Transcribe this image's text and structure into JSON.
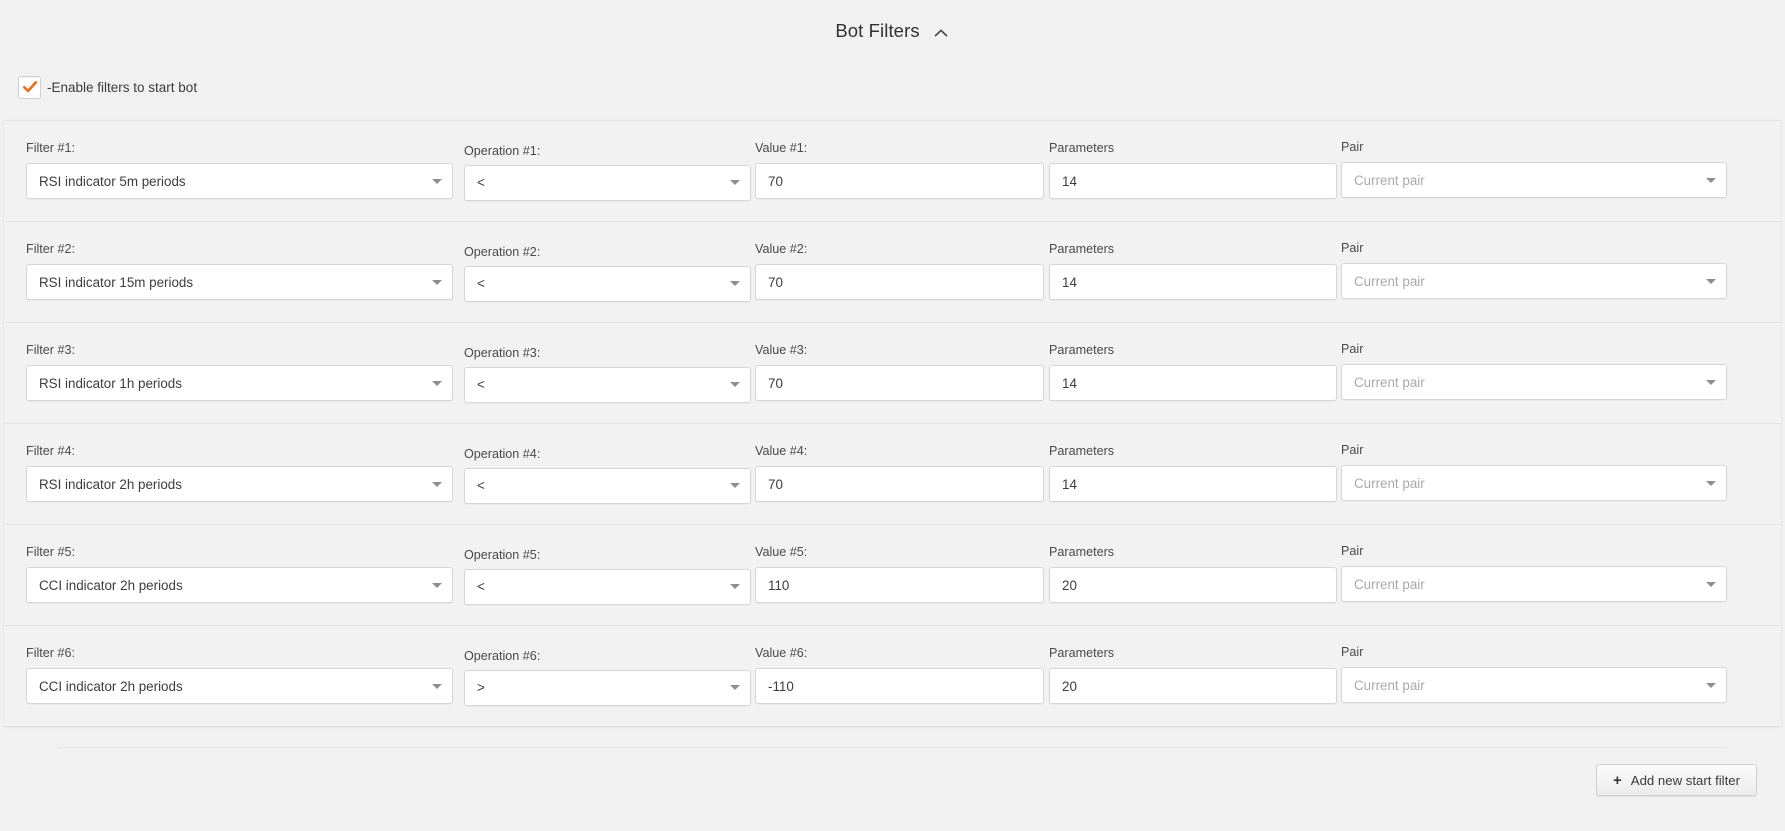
{
  "header": {
    "title": "Bot Filters",
    "collapse_icon": "chevron-up-icon"
  },
  "enable": {
    "label": "-Enable filters to start bot",
    "checked": true,
    "check_color": "#ef6c1a"
  },
  "labels": {
    "filter_prefix": "Filter #",
    "operation_prefix": "Operation #",
    "value_prefix": "Value #",
    "parameters": "Parameters",
    "pair": "Pair"
  },
  "rows": [
    {
      "index": "1",
      "filter_label": "Filter #1:",
      "filter_value": "RSI indicator 5m periods",
      "operation_label": "Operation #1:",
      "operation_value": "<",
      "value_label": "Value #1:",
      "value_value": "70",
      "parameters_label": "Parameters",
      "parameters_value": "14",
      "pair_label": "Pair",
      "pair_placeholder": "Current pair"
    },
    {
      "index": "2",
      "filter_label": "Filter #2:",
      "filter_value": "RSI indicator 15m periods",
      "operation_label": "Operation #2:",
      "operation_value": "<",
      "value_label": "Value #2:",
      "value_value": "70",
      "parameters_label": "Parameters",
      "parameters_value": "14",
      "pair_label": "Pair",
      "pair_placeholder": "Current pair"
    },
    {
      "index": "3",
      "filter_label": "Filter #3:",
      "filter_value": "RSI indicator 1h periods",
      "operation_label": "Operation #3:",
      "operation_value": "<",
      "value_label": "Value #3:",
      "value_value": "70",
      "parameters_label": "Parameters",
      "parameters_value": "14",
      "pair_label": "Pair",
      "pair_placeholder": "Current pair"
    },
    {
      "index": "4",
      "filter_label": "Filter #4:",
      "filter_value": "RSI indicator 2h periods",
      "operation_label": "Operation #4:",
      "operation_value": "<",
      "value_label": "Value #4:",
      "value_value": "70",
      "parameters_label": "Parameters",
      "parameters_value": "14",
      "pair_label": "Pair",
      "pair_placeholder": "Current pair"
    },
    {
      "index": "5",
      "filter_label": "Filter #5:",
      "filter_value": "CCI indicator 2h periods",
      "operation_label": "Operation #5:",
      "operation_value": "<",
      "value_label": "Value #5:",
      "value_value": "110",
      "parameters_label": "Parameters",
      "parameters_value": "20",
      "pair_label": "Pair",
      "pair_placeholder": "Current pair"
    },
    {
      "index": "6",
      "filter_label": "Filter #6:",
      "filter_value": "CCI indicator 2h periods",
      "operation_label": "Operation #6:",
      "operation_value": ">",
      "value_label": "Value #6:",
      "value_value": "-110",
      "parameters_label": "Parameters",
      "parameters_value": "20",
      "pair_label": "Pair",
      "pair_placeholder": "Current pair"
    }
  ],
  "footer": {
    "add_button_label": "Add new start filter",
    "add_button_icon": "plus-icon"
  },
  "colors": {
    "page_background": "#f1f1f1",
    "row_background": "#f2f2f2",
    "field_background": "#ffffff",
    "field_border": "#d6d6d6",
    "accent": "#ef6c1a",
    "text": "#3d3d3d",
    "placeholder_text": "#a9a9a9"
  }
}
